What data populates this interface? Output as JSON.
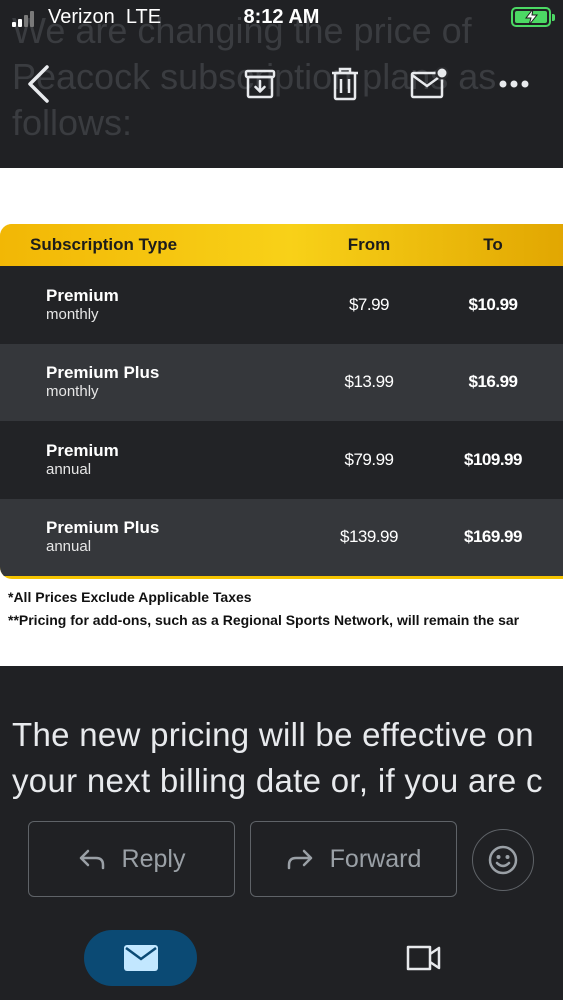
{
  "status_bar": {
    "carrier": "Verizon",
    "network": "LTE",
    "time": "8:12 AM"
  },
  "background_text": "We are changing the price of\nPeacock subscription plans as\nfollows:",
  "toolbar": {
    "icons": [
      "back-arrow-icon",
      "archive-icon",
      "trash-icon",
      "mark-unread-icon",
      "more-icon"
    ]
  },
  "price_table": {
    "headers": {
      "type": "Subscription Type",
      "from": "From",
      "to": "To"
    },
    "rows": [
      {
        "plan": "Premium",
        "period": "monthly",
        "from": "$7.99",
        "to": "$10.99"
      },
      {
        "plan": "Premium Plus",
        "period": "monthly",
        "from": "$13.99",
        "to": "$16.99"
      },
      {
        "plan": "Premium",
        "period": "annual",
        "from": "$79.99",
        "to": "$109.99"
      },
      {
        "plan": "Premium Plus",
        "period": "annual",
        "from": "$139.99",
        "to": "$169.99"
      }
    ],
    "footnote_1": "*All Prices Exclude Applicable Taxes",
    "footnote_2": "**Pricing for add-ons, such as a Regional Sports Network, will remain the sar",
    "accent_color": "#f5c400"
  },
  "body": {
    "line_1": "The new pricing will be effective on",
    "line_2": "your next billing date or, if you are c"
  },
  "actions": {
    "reply_label": "Reply",
    "forward_label": "Forward"
  },
  "bottom_nav": {
    "mail_icon": "mail-icon",
    "meet_icon": "video-camera-icon",
    "active_color": "#0b4a74"
  }
}
